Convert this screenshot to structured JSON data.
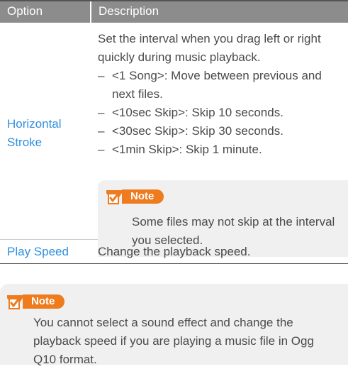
{
  "table": {
    "headers": {
      "option": "Option",
      "description": "Description"
    },
    "rows": [
      {
        "option": "Horizontal Stroke",
        "intro": "Set the interval when you drag left or right quickly during music playback.",
        "bullets": [
          "<1 Song>: Move between previous and next files.",
          "<10sec Skip>: Skip 10 seconds.",
          "<30sec Skip>: Skip 30 seconds.",
          "<1min Skip>: Skip 1 minute."
        ],
        "note": {
          "label": "Note",
          "text": "Some files may not skip at the interval you selected."
        }
      },
      {
        "option": "Play Speed",
        "description": "Change the playback speed."
      }
    ]
  },
  "note": {
    "label": "Note",
    "text": "You cannot select a sound effect and change the playback speed if you are playing a music file in Ogg Q10 format."
  },
  "colors": {
    "option_text": "#2f8fe0",
    "header_bg": "#8c8c8c",
    "note_badge": "#ee7b1e",
    "note_bg": "#f0f0f0"
  },
  "icons": {
    "note": "note-check-icon",
    "dash": "en-dash"
  }
}
